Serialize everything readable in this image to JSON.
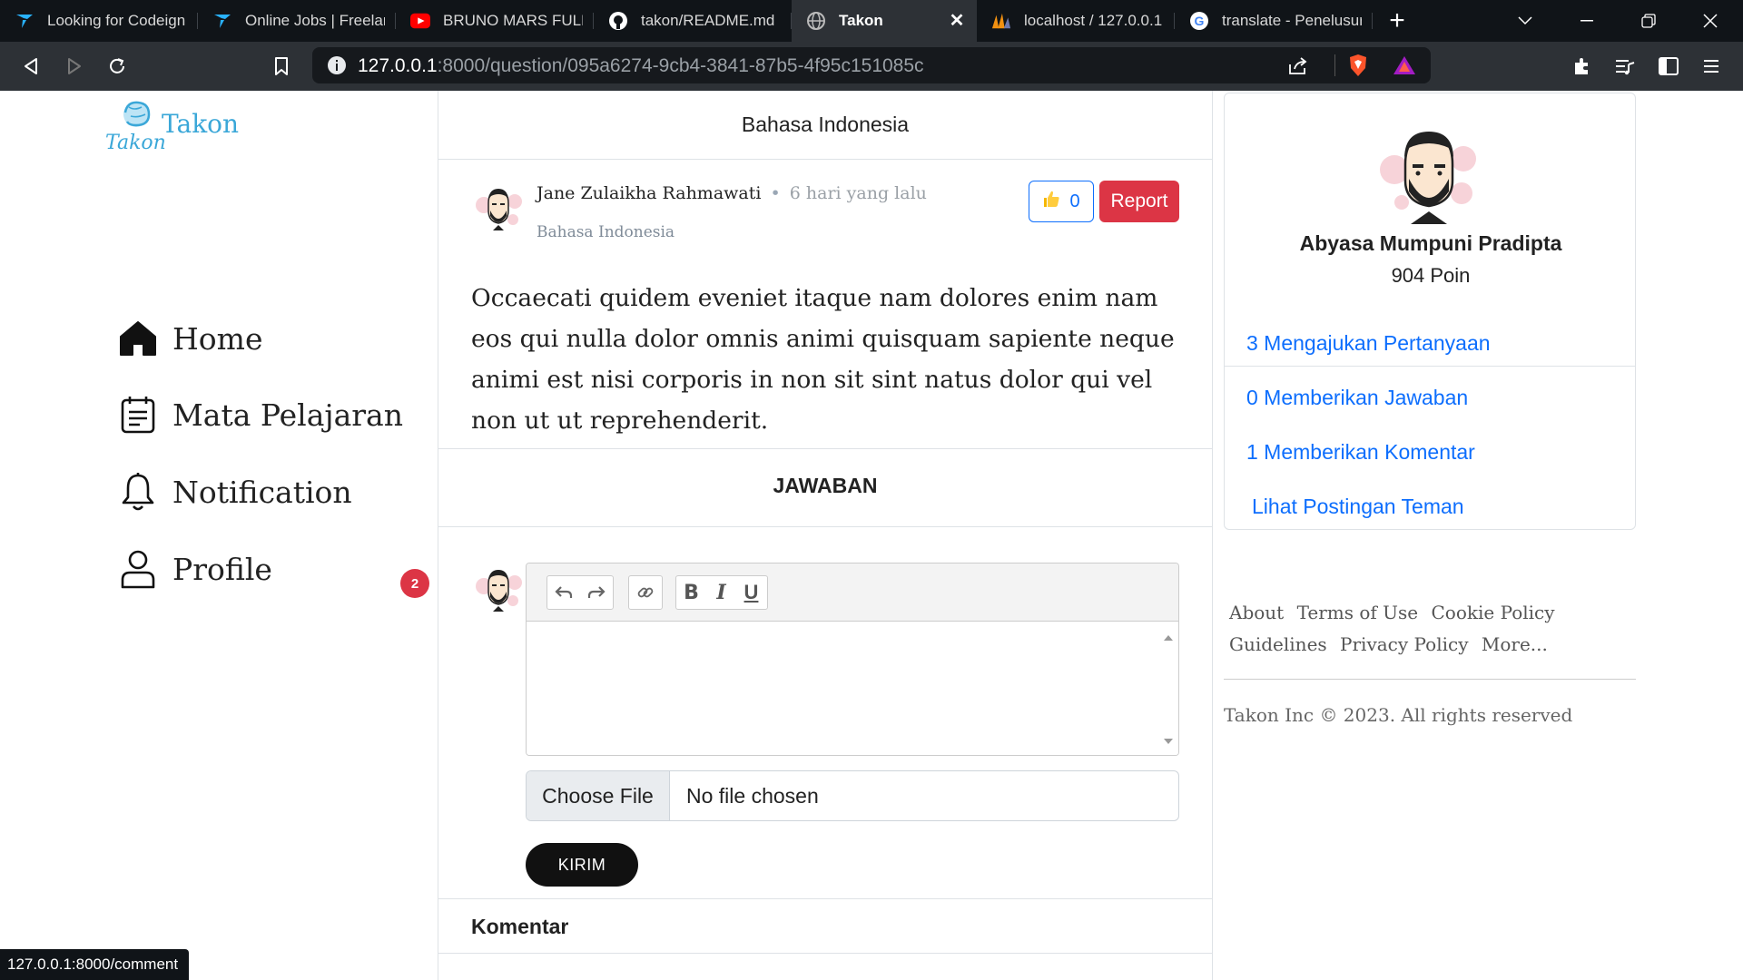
{
  "browser": {
    "tabs": [
      {
        "label": "Looking for Codeign",
        "icon": "freelancer-icon"
      },
      {
        "label": "Online Jobs | Freelan",
        "icon": "freelancer-icon"
      },
      {
        "label": "BRUNO MARS FULL",
        "icon": "youtube-icon"
      },
      {
        "label": "takon/README.md",
        "icon": "github-icon"
      },
      {
        "label": "Takon",
        "icon": "globe-icon",
        "active": true
      },
      {
        "label": "localhost / 127.0.0.1",
        "icon": "phpmyadmin-icon"
      },
      {
        "label": "translate - Penelusur",
        "icon": "google-icon"
      }
    ],
    "url_host": "127.0.0.1",
    "url_path": ":8000/question/095a6274-9cb4-3841-87b5-4f95c151085c",
    "status_url": "127.0.0.1:8000/comment"
  },
  "brand": {
    "name": "Takon",
    "accent": "#3aa7d8"
  },
  "nav": {
    "home": "Home",
    "subjects": "Mata Pelajaran",
    "notification": "Notification",
    "notification_count": "2",
    "profile": "Profile"
  },
  "question": {
    "subject_header": "Bahasa Indonesia",
    "author": "Jane Zulaikha Rahmawati",
    "separator": "•",
    "time": "6 hari yang lalu",
    "subject": "Bahasa Indonesia",
    "likes": "0",
    "report_label": "Report",
    "body": "Occaecati quidem eveniet itaque nam dolores enim nam eos qui nulla dolor omnis animi quisquam sapiente neque animi est nisi corporis in non sit sint natus dolor qui vel non ut ut reprehenderit."
  },
  "answer": {
    "title": "JAWABAN",
    "file_button": "Choose File",
    "file_status": "No file chosen",
    "submit_label": "KIRIM",
    "comments_title": "Komentar"
  },
  "profile_card": {
    "name": "Abyasa Mumpuni Pradipta",
    "points": "904 Poin",
    "stats": [
      "3 Mengajukan Pertanyaan",
      "0 Memberikan Jawaban",
      "1 Memberikan Komentar",
      "Lihat Postingan Teman"
    ]
  },
  "footer": {
    "links": [
      "About",
      "Terms of Use",
      "Cookie Policy",
      "Guidelines",
      "Privacy Policy",
      "More..."
    ],
    "copyright": "Takon Inc © 2023. All rights reserved"
  },
  "colors": {
    "primary": "#0d6efd",
    "danger": "#dc3545",
    "chrome_dark": "#101418",
    "chrome_mid": "#2d3136"
  }
}
